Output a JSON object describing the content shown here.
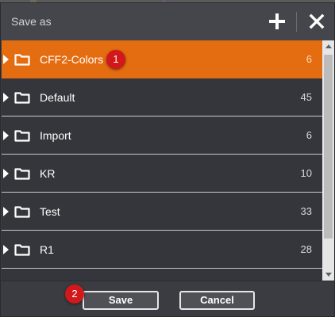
{
  "dialog": {
    "title": "Save as",
    "add_icon": "plus-icon",
    "close_icon": "close-icon"
  },
  "folders": [
    {
      "name": "CFF2-Colors",
      "count": "6",
      "selected": true
    },
    {
      "name": "Default",
      "count": "45",
      "selected": false
    },
    {
      "name": "Import",
      "count": "6",
      "selected": false
    },
    {
      "name": "KR",
      "count": "10",
      "selected": false
    },
    {
      "name": "Test",
      "count": "33",
      "selected": false
    },
    {
      "name": "R1",
      "count": "28",
      "selected": false
    }
  ],
  "footer": {
    "save_label": "Save",
    "cancel_label": "Cancel"
  },
  "annotations": {
    "marker_1": "1",
    "marker_2": "2"
  },
  "colors": {
    "accent": "#e56d11",
    "marker": "#d2181a"
  }
}
